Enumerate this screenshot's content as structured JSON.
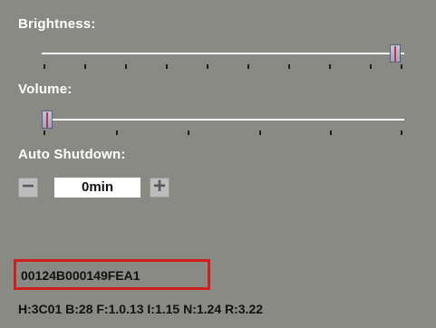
{
  "settings": {
    "brightness": {
      "label": "Brightness:",
      "level": 1.0
    },
    "volume": {
      "label": "Volume:",
      "level": 0.0
    },
    "auto_shutdown": {
      "label": "Auto Shutdown:",
      "value": "0min",
      "decrement_glyph": "−",
      "increment_glyph": "+"
    }
  },
  "device": {
    "serial": "00124B000149FEA1",
    "firmware_info": "H:3C01 B:28 F:1.0.13 I:1.15 N:1.24 R:3.22"
  },
  "colors": {
    "background": "#898a84",
    "highlight_box": "#d11f1f",
    "slider_thumb": "#9aa3c4",
    "thumb_mark": "#c0343a"
  }
}
